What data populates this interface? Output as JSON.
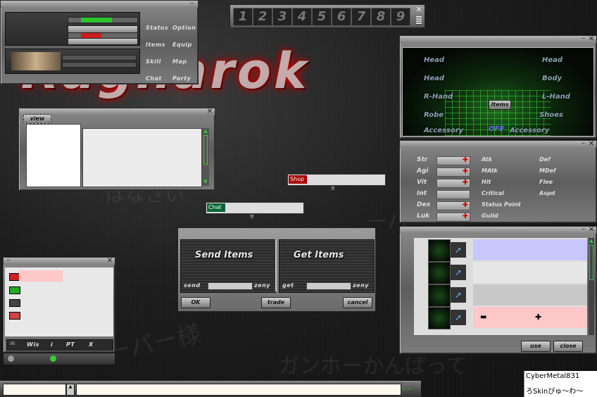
{
  "background": {
    "logo_text": "Ragnarok",
    "watermark_lines": [
      "ばなさい",
      "ーバー",
      "ガンホーかんばって",
      "ーバー様"
    ]
  },
  "basic_info": {
    "menu": [
      "Status",
      "Option",
      "Items",
      "Equip",
      "Skill",
      "Map",
      "Chat",
      "Party"
    ],
    "hp_color": "#2ec42e",
    "sp_color": "#c81e1e"
  },
  "hotbar": {
    "slots": [
      "1",
      "2",
      "3",
      "4",
      "5",
      "6",
      "7",
      "8",
      "9"
    ]
  },
  "view_window": {
    "tab_label": "view"
  },
  "shop_field": {
    "label": "Shop"
  },
  "chat_field": {
    "label": "Chat"
  },
  "trade": {
    "send_title": "Send Items",
    "get_title": "Get Items",
    "send_label": "send",
    "get_label": "get",
    "zeny_label": "zeny",
    "ok_label": "OK",
    "trade_label": "trade",
    "cancel_label": "cancel"
  },
  "equipment": {
    "left": [
      "Head",
      "Head",
      "R-Hand",
      "Robe",
      "Accessory"
    ],
    "right": [
      "Head",
      "Body",
      "L-Hand",
      "Shoes",
      "Accessory"
    ],
    "center_label": "Items",
    "toggle_label": "OFF"
  },
  "status": {
    "stats": [
      "Str",
      "Agi",
      "Vit",
      "Int",
      "Dex",
      "Luk"
    ],
    "right_col1": [
      "Atk",
      "MAtk",
      "Hit",
      "Critical",
      "Status Point",
      "Guild"
    ],
    "right_col2": [
      "Def",
      "MDef",
      "Flee",
      "Aspd"
    ]
  },
  "inventory": {
    "use_label": "use",
    "close_label": "close",
    "row_colors": [
      "#c8c8ff",
      "#e6e6e6",
      "#c8c8c8",
      "#ffc8c8"
    ]
  },
  "party": {
    "footer_items": [
      "Wis",
      "i",
      "PT",
      "X"
    ],
    "swatch_colors": [
      "#cc2222",
      "#22aa22",
      "#444444",
      "#cc4444"
    ],
    "highlight_color": "#ffc8c8"
  },
  "chat_bar": {
    "input_value": "",
    "scroll_glyph": "▲"
  },
  "credit": {
    "line1": "CyberMetal831",
    "line2": "ろSkinぴゅ〜わ〜"
  }
}
